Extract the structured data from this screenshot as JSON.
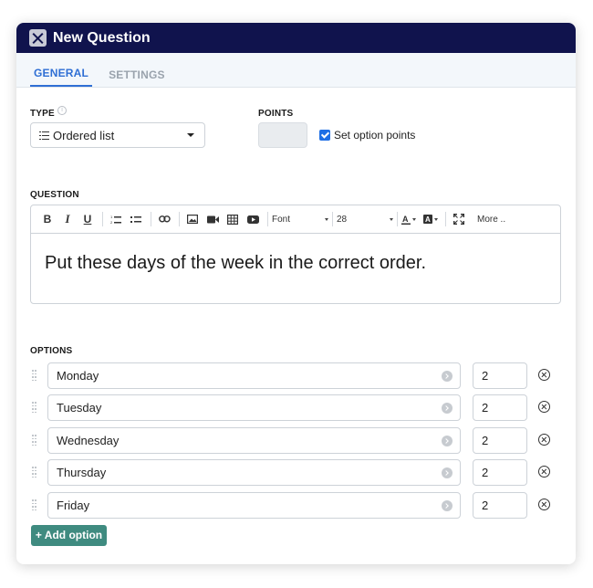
{
  "window": {
    "title": "New Question"
  },
  "tabs": [
    {
      "label": "GENERAL",
      "active": true
    },
    {
      "label": "SETTINGS",
      "active": false
    }
  ],
  "type_field": {
    "label": "TYPE",
    "value": "Ordered list"
  },
  "points_field": {
    "label": "POINTS",
    "value": "",
    "checkbox_label": "Set option points",
    "checked": true
  },
  "question": {
    "label": "QUESTION",
    "toolbar": {
      "bold": "B",
      "italic": "I",
      "underline": "U",
      "font": "Font",
      "size": "28",
      "more": "More .."
    },
    "text": "Put these days of the week in the correct order."
  },
  "options": {
    "label": "OPTIONS",
    "items": [
      {
        "text": "Monday",
        "points": "2"
      },
      {
        "text": "Tuesday",
        "points": "2"
      },
      {
        "text": "Wednesday",
        "points": "2"
      },
      {
        "text": "Thursday",
        "points": "2"
      },
      {
        "text": "Friday",
        "points": "2"
      }
    ],
    "add_label": "+ Add option"
  },
  "colors": {
    "titlebar": "#10134d",
    "accent": "#2f6fd4",
    "add_button": "#3f8b80",
    "checkbox": "#1f6fe5"
  }
}
